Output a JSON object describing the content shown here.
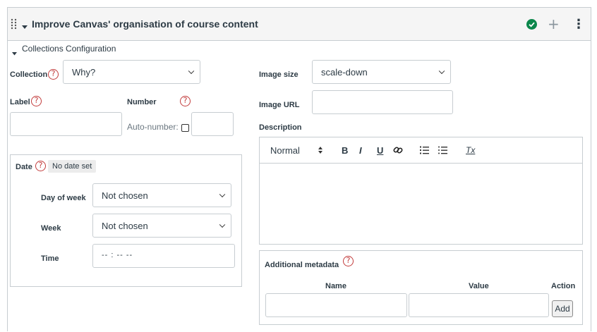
{
  "header": {
    "title": "Improve Canvas' organisation of course content",
    "add_glyph": "+",
    "more_glyph": "⋮",
    "status_color": "#0b874b"
  },
  "section": {
    "title": "Collections Configuration"
  },
  "help_glyph": "?",
  "collection": {
    "label": "Collection",
    "value": "Why?"
  },
  "label_field": {
    "label": "Label",
    "value": ""
  },
  "number_field": {
    "label": "Number",
    "auto_label": "Auto-number:",
    "value": ""
  },
  "date": {
    "label": "Date",
    "status": "No date set",
    "day_of_week": {
      "label": "Day of week",
      "value": "Not chosen"
    },
    "week": {
      "label": "Week",
      "value": "Not chosen"
    },
    "time": {
      "label": "Time",
      "placeholder": "-- : --  --"
    }
  },
  "image_size": {
    "label": "Image size",
    "value": "scale-down"
  },
  "image_url": {
    "label": "Image URL",
    "value": ""
  },
  "description": {
    "label": "Description",
    "format_value": "Normal",
    "toolbar": {
      "bold": "B",
      "italic": "I",
      "underline": "U",
      "clear_format": "Tx"
    }
  },
  "metadata": {
    "label": "Additional metadata",
    "columns": [
      "Name",
      "Value",
      "Action"
    ],
    "add_label": "Add"
  }
}
